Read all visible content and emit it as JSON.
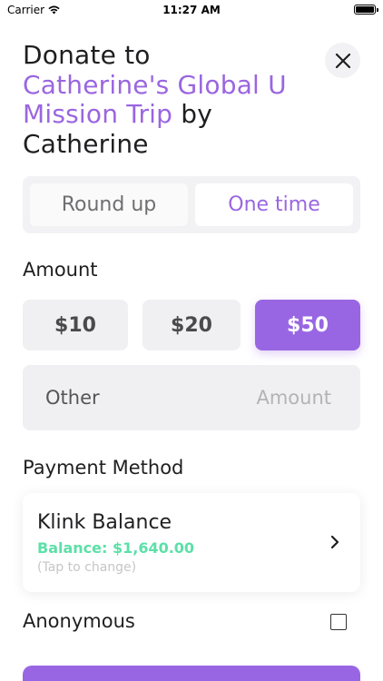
{
  "status_bar": {
    "carrier": "Carrier",
    "time": "11:27 AM"
  },
  "header": {
    "title_prefix": "Donate to",
    "campaign_line1": "Catherine's Global U",
    "campaign_line2": "Mission Trip",
    "by_word": "by",
    "author": "Catherine",
    "close_icon": "close-icon"
  },
  "frequency": {
    "options": [
      "Round up",
      "One time"
    ],
    "selected": "One time"
  },
  "amount": {
    "heading": "Amount",
    "options": [
      "$10",
      "$20",
      "$50"
    ],
    "selected": "$50",
    "other_label": "Other",
    "other_placeholder": "Amount",
    "other_value": ""
  },
  "payment": {
    "heading": "Payment Method",
    "method_name": "Klink Balance",
    "balance_text": "Balance: $1,640.00",
    "hint": "(Tap to change)",
    "chevron_icon": "chevron-right-icon"
  },
  "anonymous": {
    "label": "Anonymous",
    "checked": false
  },
  "colors": {
    "accent": "#9a66e0",
    "balance_green": "#5ce0a8",
    "button_gray": "#f0f0f2"
  }
}
